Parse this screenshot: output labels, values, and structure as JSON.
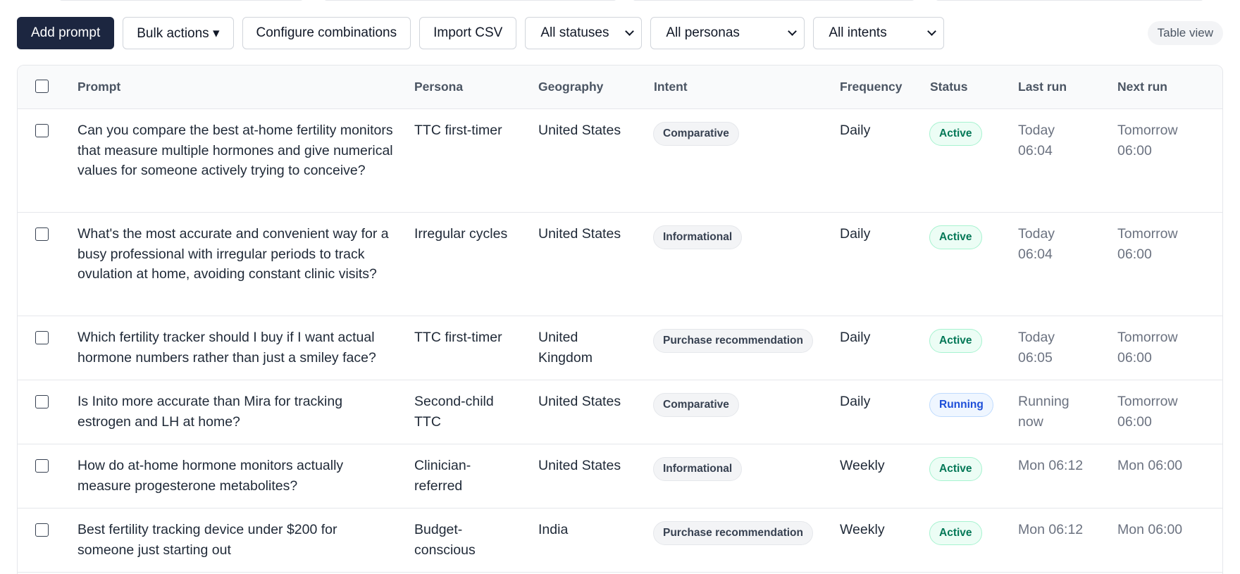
{
  "toolbar": {
    "add_prompt": "Add prompt",
    "bulk_actions": "Bulk actions ▾",
    "configure_combinations": "Configure combinations",
    "import_csv": "Import CSV",
    "filter_status": "All statuses",
    "filter_persona": "All personas",
    "filter_intent": "All intents",
    "view_toggle": "Table view"
  },
  "table": {
    "headers": {
      "prompt": "Prompt",
      "persona": "Persona",
      "geography": "Geography",
      "intent": "Intent",
      "frequency": "Frequency",
      "status": "Status",
      "last_run": "Last run",
      "next_run": "Next run"
    },
    "rows": [
      {
        "prompt": "Can you compare the best at-home fertility monitors that measure multiple hormones and give numerical values for someone actively trying to conceive?",
        "persona": "TTC first-timer",
        "geography": "United States",
        "intent": "Comparative",
        "frequency": "Daily",
        "status": "Active",
        "last_run": "Today 06:04",
        "next_run": "Tomorrow 06:00"
      },
      {
        "prompt": "What's the most accurate and convenient way for a busy professional with irregular periods to track ovulation at home, avoiding constant clinic visits?",
        "persona": "Irregular cycles",
        "geography": "United States",
        "intent": "Informational",
        "frequency": "Daily",
        "status": "Active",
        "last_run": "Today 06:04",
        "next_run": "Tomorrow 06:00"
      },
      {
        "prompt": "Which fertility tracker should I buy if I want actual hormone numbers rather than just a smiley face?",
        "persona": "TTC first-timer",
        "geography": "United Kingdom",
        "intent": "Purchase recommendation",
        "frequency": "Daily",
        "status": "Active",
        "last_run": "Today 06:05",
        "next_run": "Tomorrow 06:00"
      },
      {
        "prompt": "Is Inito more accurate than Mira for tracking estrogen and LH at home?",
        "persona": "Second-child TTC",
        "geography": "United States",
        "intent": "Comparative",
        "frequency": "Daily",
        "status": "Running",
        "last_run": "Running now",
        "next_run": "Tomorrow 06:00"
      },
      {
        "prompt": "How do at-home hormone monitors actually measure progesterone metabolites?",
        "persona": "Clinician-referred",
        "geography": "United States",
        "intent": "Informational",
        "frequency": "Weekly",
        "status": "Active",
        "last_run": "Mon 06:12",
        "next_run": "Mon 06:00"
      },
      {
        "prompt": "Best fertility tracking device under $200 for someone just starting out",
        "persona": "Budget-conscious",
        "geography": "India",
        "intent": "Purchase recommendation",
        "frequency": "Weekly",
        "status": "Active",
        "last_run": "Mon 06:12",
        "next_run": "Mon 06:00"
      }
    ]
  }
}
